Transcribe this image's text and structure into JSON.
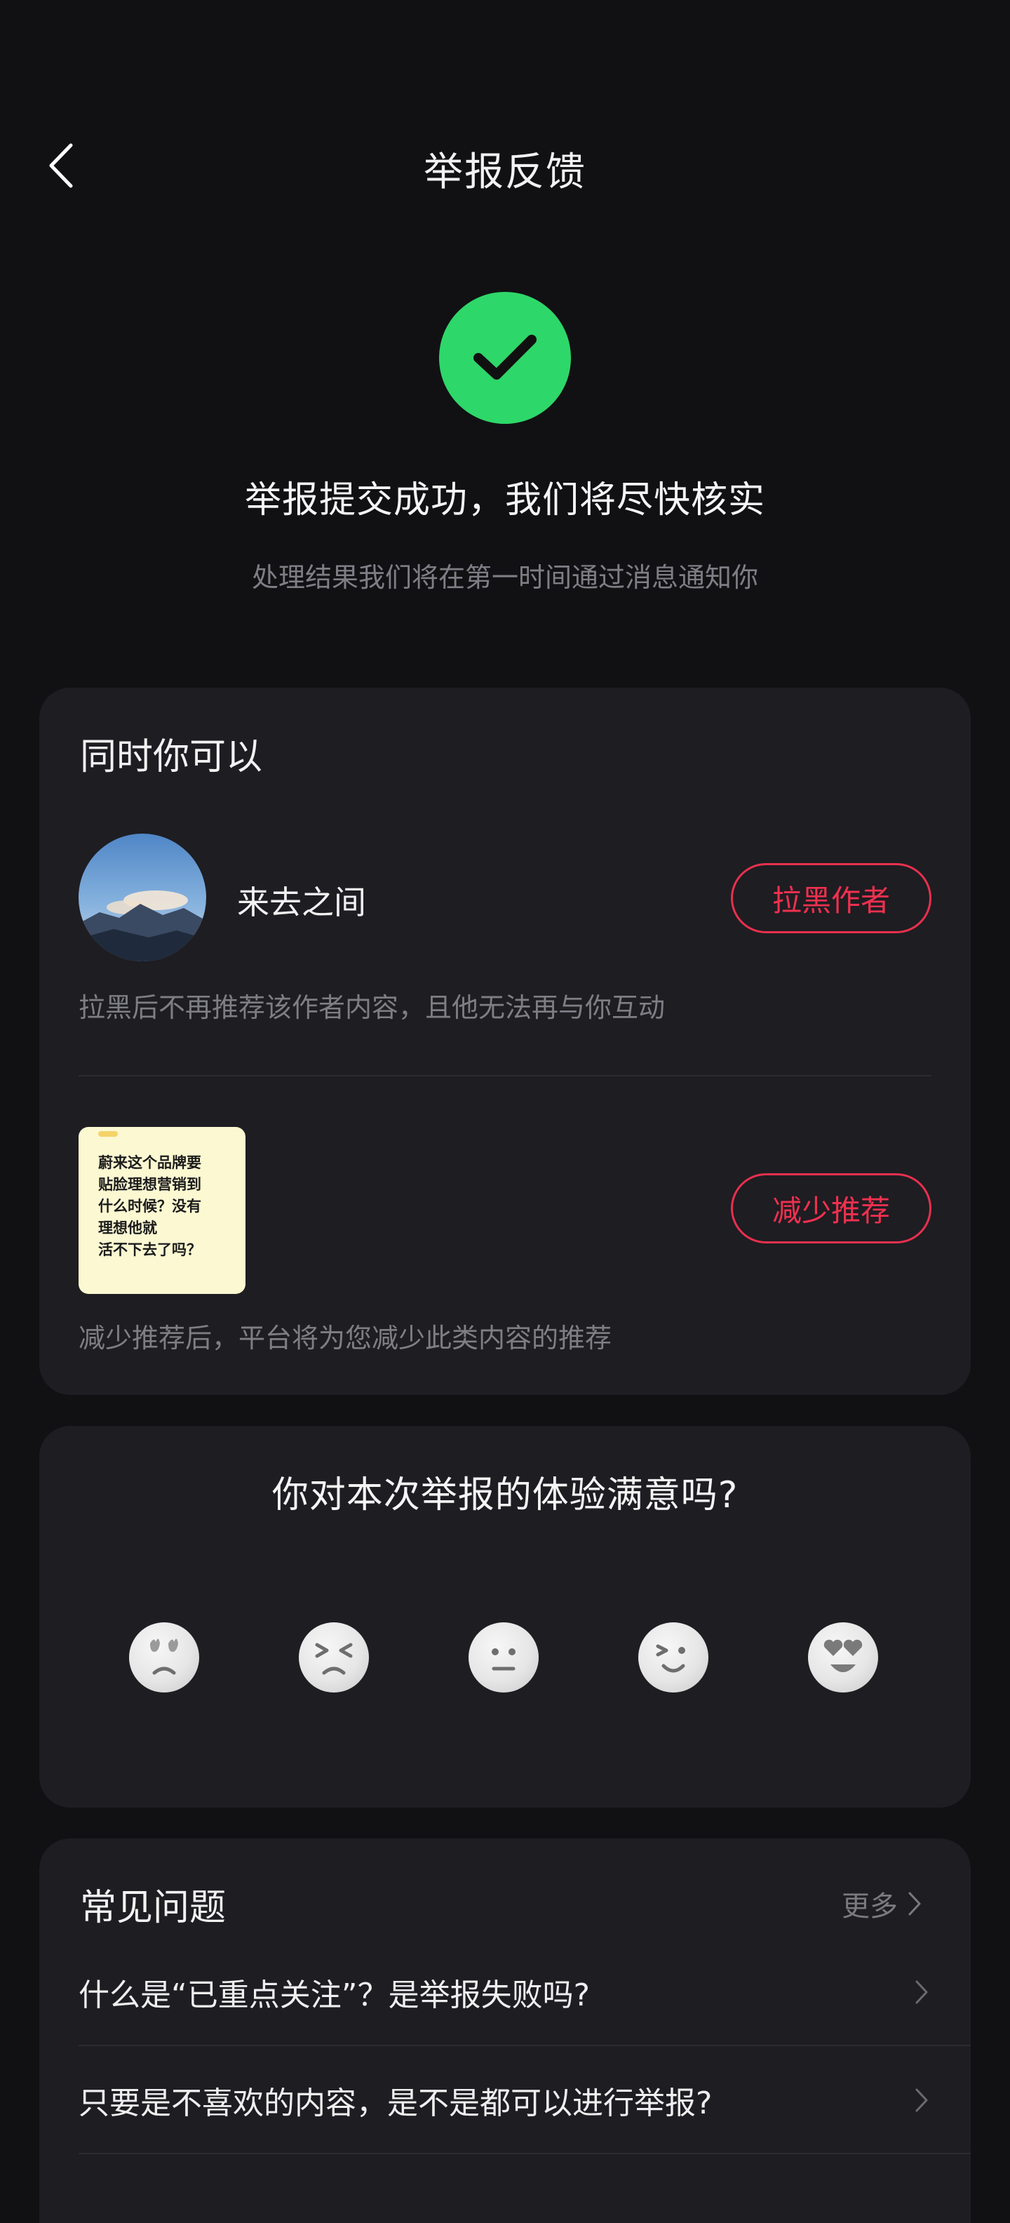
{
  "header": {
    "title": "举报反馈",
    "back_icon": "chevron-left-icon"
  },
  "success": {
    "icon": "checkmark-icon",
    "icon_color": "#2ed769",
    "title": "举报提交成功，我们将尽快核实",
    "subtitle": "处理结果我们将在第一时间通过消息通知你"
  },
  "actions": {
    "heading": "同时你可以",
    "author": {
      "name": "来去之间",
      "button": "拉黑作者",
      "description": "拉黑后不再推荐该作者内容，且他无法再与你互动"
    },
    "content": {
      "thumbnail_text": "蔚来这个品牌要\n贴脸理想营销到\n什么时候？没有\n理想他就\n活不下去了吗？",
      "button": "减少推荐",
      "description": "减少推荐后，平台将为您减少此类内容的推荐"
    },
    "accent_color": "#f0304f"
  },
  "rating": {
    "title": "你对本次举报的体验满意吗?",
    "emojis": [
      "angry-face-icon",
      "squinting-sad-face-icon",
      "neutral-face-icon",
      "smiling-face-icon",
      "heart-eyes-face-icon"
    ]
  },
  "faq": {
    "title": "常见问题",
    "more": "更多",
    "items": [
      {
        "question": "什么是“已重点关注”？是举报失败吗?"
      },
      {
        "question": "只要是不喜欢的内容，是不是都可以进行举报?"
      }
    ]
  }
}
